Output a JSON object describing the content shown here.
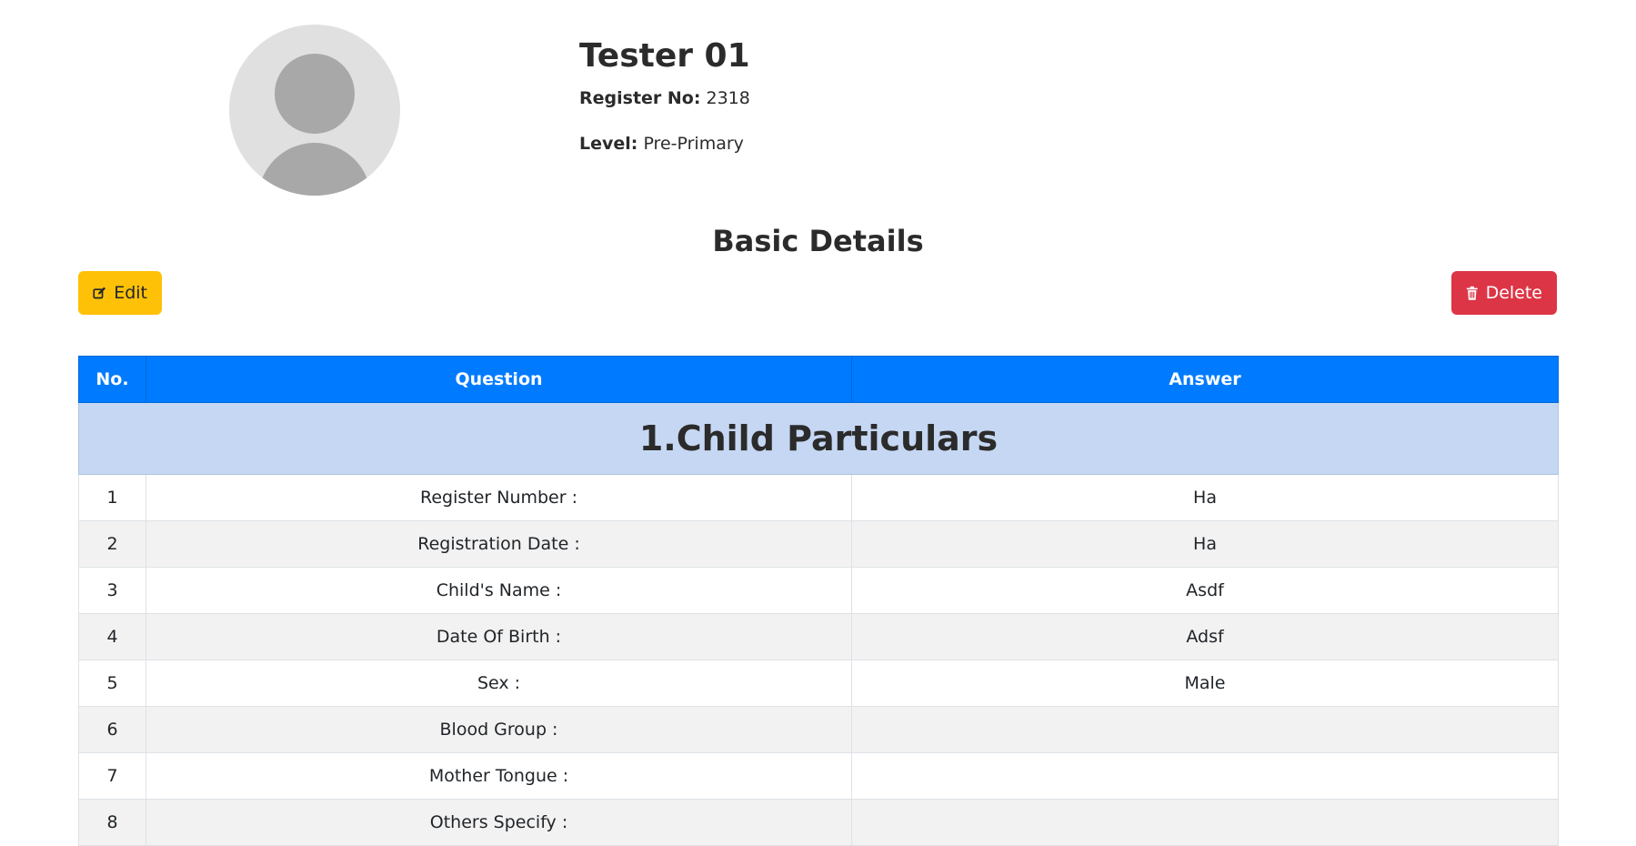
{
  "profile": {
    "name": "Tester 01",
    "register_label": "Register No:",
    "register_value": "2318",
    "level_label": "Level:",
    "level_value": "Pre-Primary"
  },
  "section_title": "Basic Details",
  "actions": {
    "edit_label": "Edit",
    "edit_icon": "edit-icon",
    "delete_label": "Delete",
    "delete_icon": "trash-icon",
    "edit_color": "#ffc107",
    "delete_color": "#dc3545"
  },
  "table": {
    "header_color": "#007bff",
    "columns": [
      "No.",
      "Question",
      "Answer"
    ],
    "group_title": "1.Child Particulars",
    "rows": [
      {
        "no": "1",
        "question": "Register Number :",
        "answer": "Ha"
      },
      {
        "no": "2",
        "question": "Registration Date :",
        "answer": "Ha"
      },
      {
        "no": "3",
        "question": "Child's Name :",
        "answer": "Asdf"
      },
      {
        "no": "4",
        "question": "Date Of Birth :",
        "answer": "Adsf"
      },
      {
        "no": "5",
        "question": "Sex :",
        "answer": "Male"
      },
      {
        "no": "6",
        "question": "Blood Group :",
        "answer": ""
      },
      {
        "no": "7",
        "question": "Mother Tongue :",
        "answer": ""
      },
      {
        "no": "8",
        "question": "Others Specify :",
        "answer": ""
      }
    ]
  }
}
